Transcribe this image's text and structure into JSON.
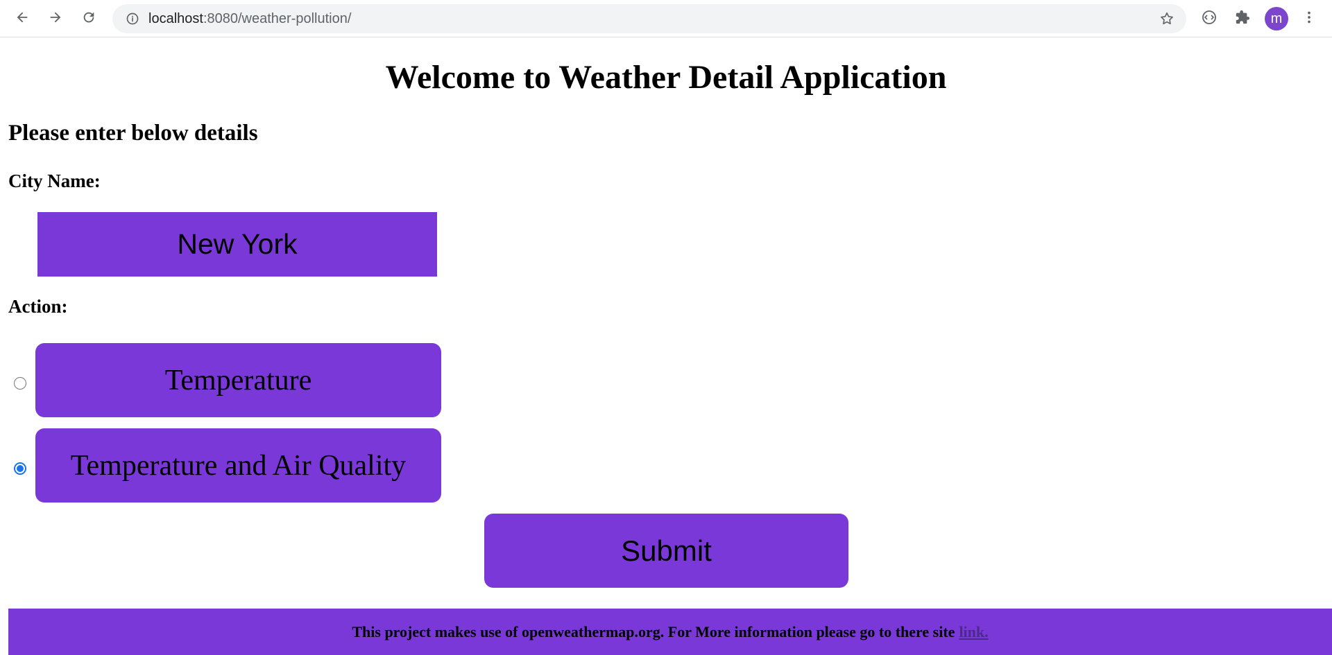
{
  "browser": {
    "url_host": "localhost",
    "url_rest": ":8080/weather-pollution/",
    "profile_initial": "m"
  },
  "page": {
    "title": "Welcome to Weather Detail Application",
    "subheading": "Please enter below details",
    "city_label": "City Name:",
    "city_value": "New York",
    "action_label": "Action:",
    "options": [
      {
        "label": "Temperature",
        "checked": false
      },
      {
        "label": "Temperature and Air Quality",
        "checked": true
      }
    ],
    "submit_label": "Submit",
    "footer_text": "This project makes use of openweathermap.org. For More information please go to there site",
    "footer_link": "link."
  },
  "colors": {
    "accent": "#7b38d9",
    "radio_checked": "#1a73e8",
    "avatar": "#7b46cc"
  }
}
